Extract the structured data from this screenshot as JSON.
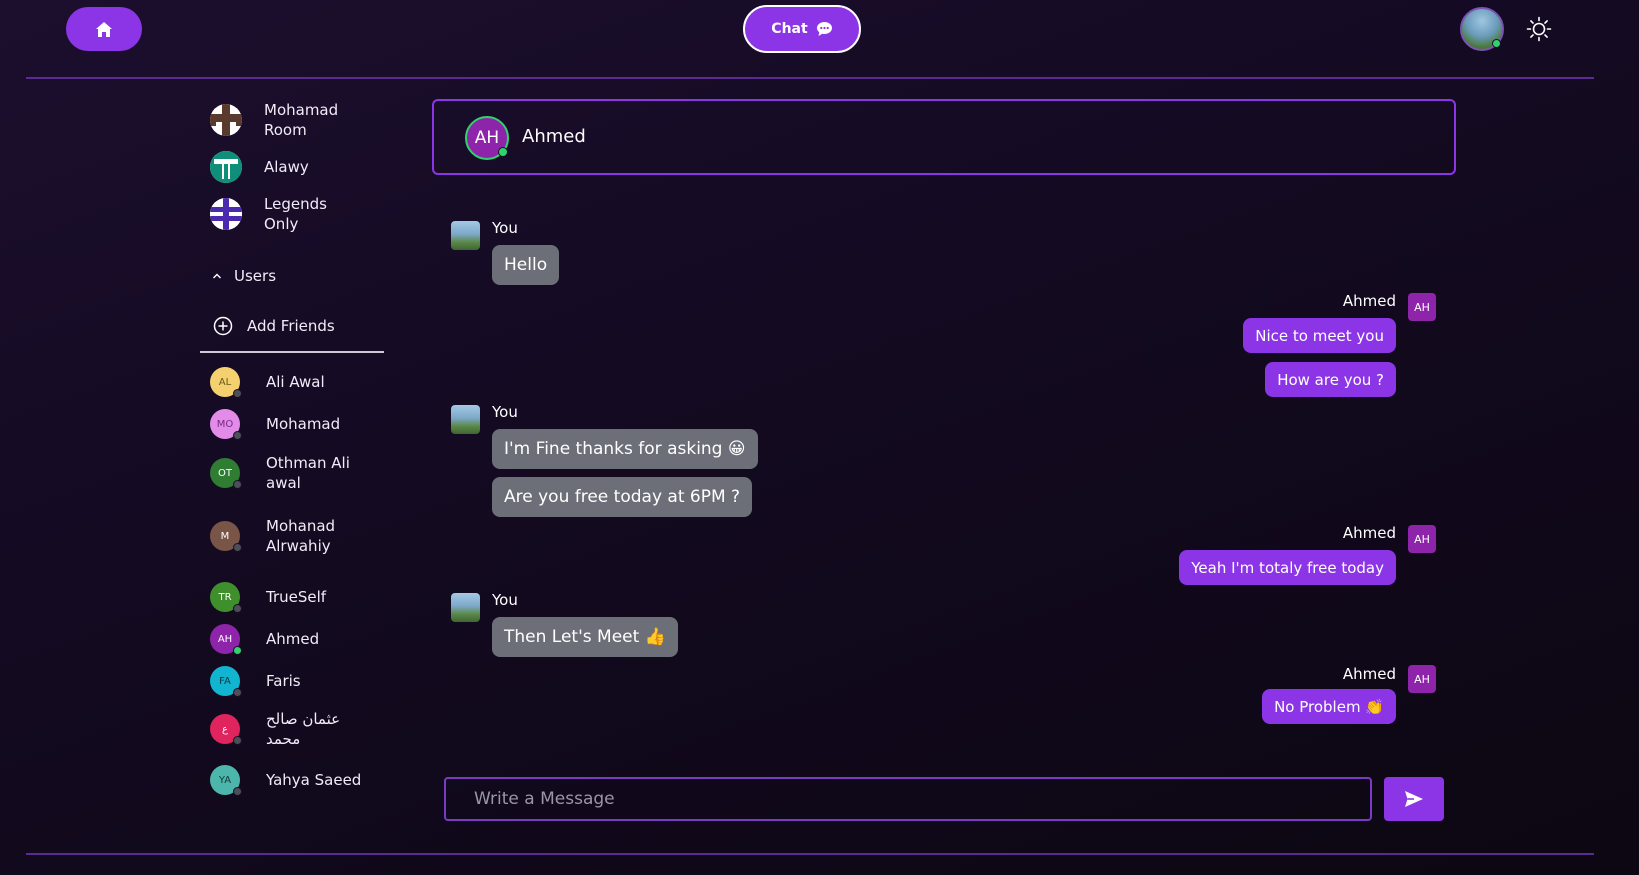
{
  "topbar": {
    "chat_label": "Chat",
    "home_icon": "home-icon",
    "chat_icon": "chat-bubble-icon",
    "theme_icon": "sun-icon"
  },
  "sidebar": {
    "rooms": [
      {
        "label": "Mohamad Room",
        "pattern": "brown"
      },
      {
        "label": "Alawy",
        "pattern": "teal"
      },
      {
        "label": "Legends Only",
        "pattern": "purple"
      }
    ],
    "users_toggle_label": "Users",
    "add_friends_label": "Add Friends",
    "users": [
      {
        "name": "Ali Awal",
        "initials": "AL",
        "color": "#f4d06f",
        "text_color": "#6b5a1e",
        "online": false
      },
      {
        "name": "Mohamad",
        "initials": "MO",
        "color": "#e28be8",
        "text_color": "#7a2a82",
        "online": false
      },
      {
        "name": "Othman Ali awal",
        "initials": "OT",
        "color": "#2e7d32",
        "text_color": "#ffffff",
        "online": false
      },
      {
        "name": "Mohanad Alrwahiy",
        "initials": "M",
        "color": "#795548",
        "text_color": "#ffffff",
        "online": false
      },
      {
        "name": "TrueSelf",
        "initials": "TR",
        "color": "#3f8f2d",
        "text_color": "#ffffff",
        "online": false
      },
      {
        "name": "Ahmed",
        "initials": "AH",
        "color": "#8e24aa",
        "text_color": "#ffffff",
        "online": true
      },
      {
        "name": "Faris",
        "initials": "FA",
        "color": "#12b5d0",
        "text_color": "#0a3b44",
        "online": false
      },
      {
        "name": "عثمان صالح محمد",
        "initials": "ع",
        "color": "#e0245e",
        "text_color": "#ffffff",
        "online": false
      },
      {
        "name": "Yahya Saeed",
        "initials": "YA",
        "color": "#4db6ac",
        "text_color": "#0d3d38",
        "online": false
      }
    ],
    "online_color": "#2fd36b",
    "offline_color": "#4b4f57"
  },
  "chat": {
    "contact_name": "Ahmed",
    "contact_initials": "AH",
    "you_label": "You",
    "other_label": "Ahmed",
    "groups": [
      {
        "from": "you",
        "messages": [
          "Hello"
        ]
      },
      {
        "from": "other",
        "messages": [
          "Nice to meet you",
          "How are you ?"
        ]
      },
      {
        "from": "you",
        "messages": [
          "I'm Fine thanks for asking 😀",
          "Are you free today at 6PM ?"
        ]
      },
      {
        "from": "other",
        "messages": [
          "Yeah I'm totaly free today"
        ]
      },
      {
        "from": "you",
        "messages": [
          "Then Let's Meet 👍"
        ]
      },
      {
        "from": "other",
        "messages": [
          "No Problem 👏"
        ]
      }
    ]
  },
  "composer": {
    "placeholder": "Write a Message",
    "value": "",
    "send_icon": "send-arrow-icon"
  },
  "colors": {
    "accent": "#8b35e6",
    "you_bubble": "#6c6f78",
    "avatar_ah": "#8e24aa"
  }
}
